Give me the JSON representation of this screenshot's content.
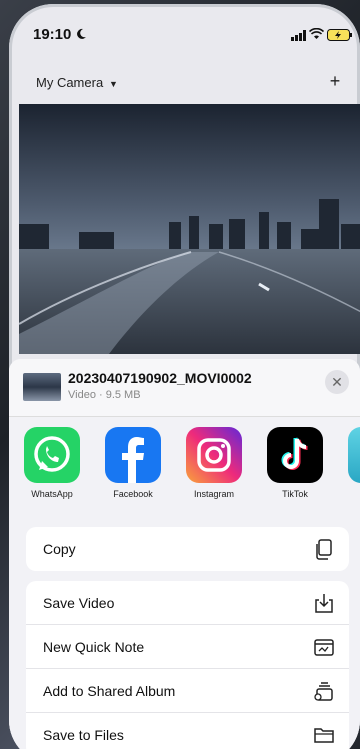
{
  "status": {
    "time": "19:10"
  },
  "header": {
    "camera_label": "My Camera",
    "add_label": "+"
  },
  "file": {
    "name": "20230407190902_MOVI0002",
    "meta": "Video · 9.5 MB",
    "close_label": "✕"
  },
  "apps": [
    {
      "label": "WhatsApp",
      "icon": "whatsapp-icon",
      "color": "#25D366"
    },
    {
      "label": "Facebook",
      "icon": "facebook-icon",
      "color": "#1877F2"
    },
    {
      "label": "Instagram",
      "icon": "instagram-icon",
      "color": "#E1306C"
    },
    {
      "label": "TikTok",
      "icon": "tiktok-icon",
      "color": "#000000"
    }
  ],
  "actions": {
    "copy": "Copy",
    "save_video": "Save Video",
    "new_quick_note": "New Quick Note",
    "add_shared_album": "Add to Shared Album",
    "save_files": "Save to Files"
  }
}
